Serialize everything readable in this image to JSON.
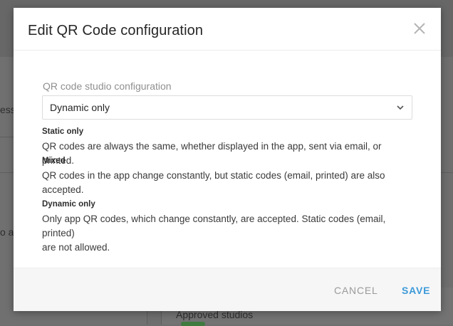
{
  "background": {
    "partial_text_left_1": "ess",
    "partial_text_left_2": "o at",
    "approved_studios": "Approved studios"
  },
  "modal": {
    "title": "Edit QR Code configuration",
    "close_icon": "close-icon",
    "field_label": "QR code studio configuration",
    "select_value": "Dynamic only",
    "options": [
      {
        "title": "Static only",
        "line1": "QR codes are always the same, whether displayed in the app, sent via email, or printed.",
        "line2": ""
      },
      {
        "title": "Mixed",
        "line1": "QR codes in the app change constantly, but static codes (email, printed) are also",
        "line2": "accepted."
      },
      {
        "title": "Dynamic only",
        "line1": "Only app QR codes, which change constantly, are accepted. Static codes (email, printed)",
        "line2": "are not allowed."
      }
    ],
    "cancel_label": "CANCEL",
    "save_label": "SAVE"
  },
  "colors": {
    "accent": "#3d9ad8",
    "overlay": "#6e6e6e"
  }
}
